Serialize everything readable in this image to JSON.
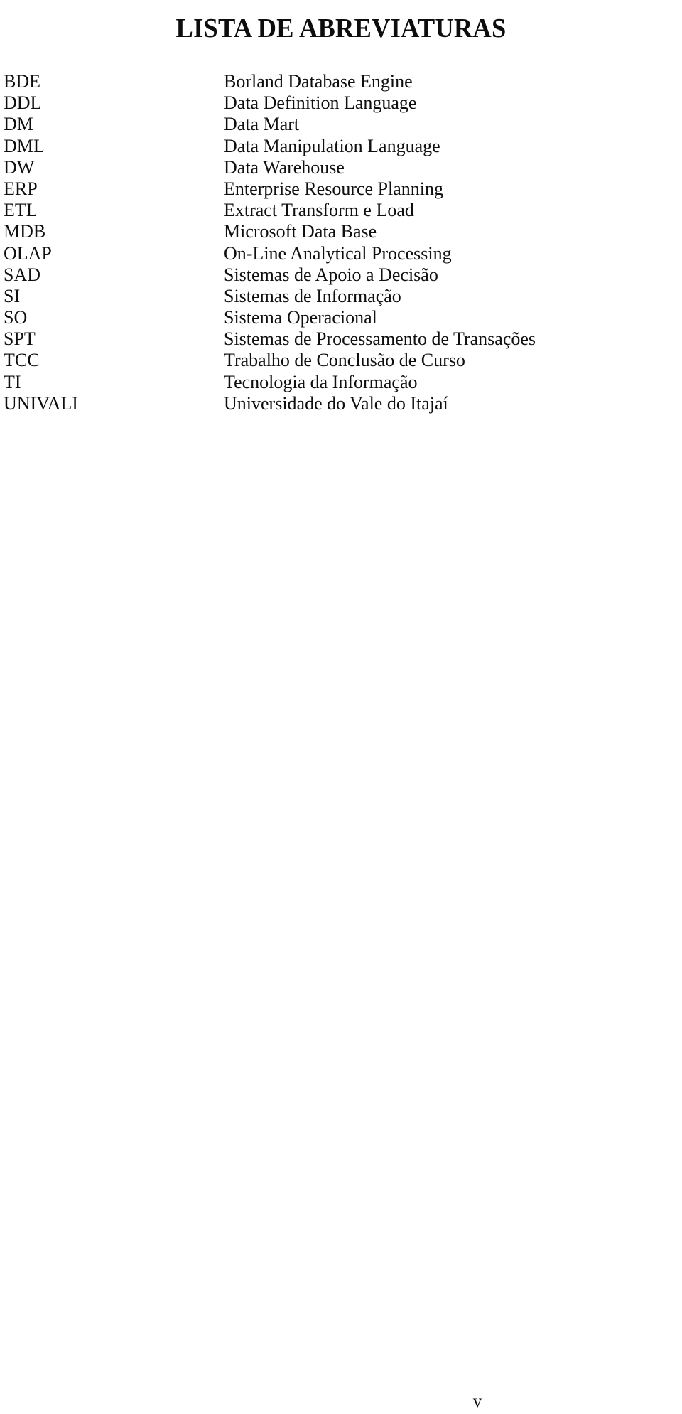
{
  "document": {
    "title": "LISTA DE ABREVIATURAS",
    "page_number": "v"
  },
  "abbreviations": [
    {
      "term": "BDE",
      "definition": "Borland Database Engine"
    },
    {
      "term": "DDL",
      "definition": "Data Definition Language"
    },
    {
      "term": "DM",
      "definition": "Data Mart"
    },
    {
      "term": "DML",
      "definition": "Data Manipulation Language"
    },
    {
      "term": "DW",
      "definition": "Data Warehouse"
    },
    {
      "term": "ERP",
      "definition": "Enterprise Resource Planning"
    },
    {
      "term": "ETL",
      "definition": "Extract Transform e Load"
    },
    {
      "term": "MDB",
      "definition": "Microsoft Data Base"
    },
    {
      "term": "OLAP",
      "definition": "On-Line Analytical Processing"
    },
    {
      "term": "SAD",
      "definition": "Sistemas de Apoio a Decisão"
    },
    {
      "term": "SI",
      "definition": "Sistemas de Informação"
    },
    {
      "term": "SO",
      "definition": "Sistema Operacional"
    },
    {
      "term": "SPT",
      "definition": "Sistemas de Processamento de Transações"
    },
    {
      "term": "TCC",
      "definition": "Trabalho de Conclusão de Curso"
    },
    {
      "term": "TI",
      "definition": "Tecnologia da Informação"
    },
    {
      "term": "UNIVALI",
      "definition": "Universidade do Vale do Itajaí"
    }
  ]
}
